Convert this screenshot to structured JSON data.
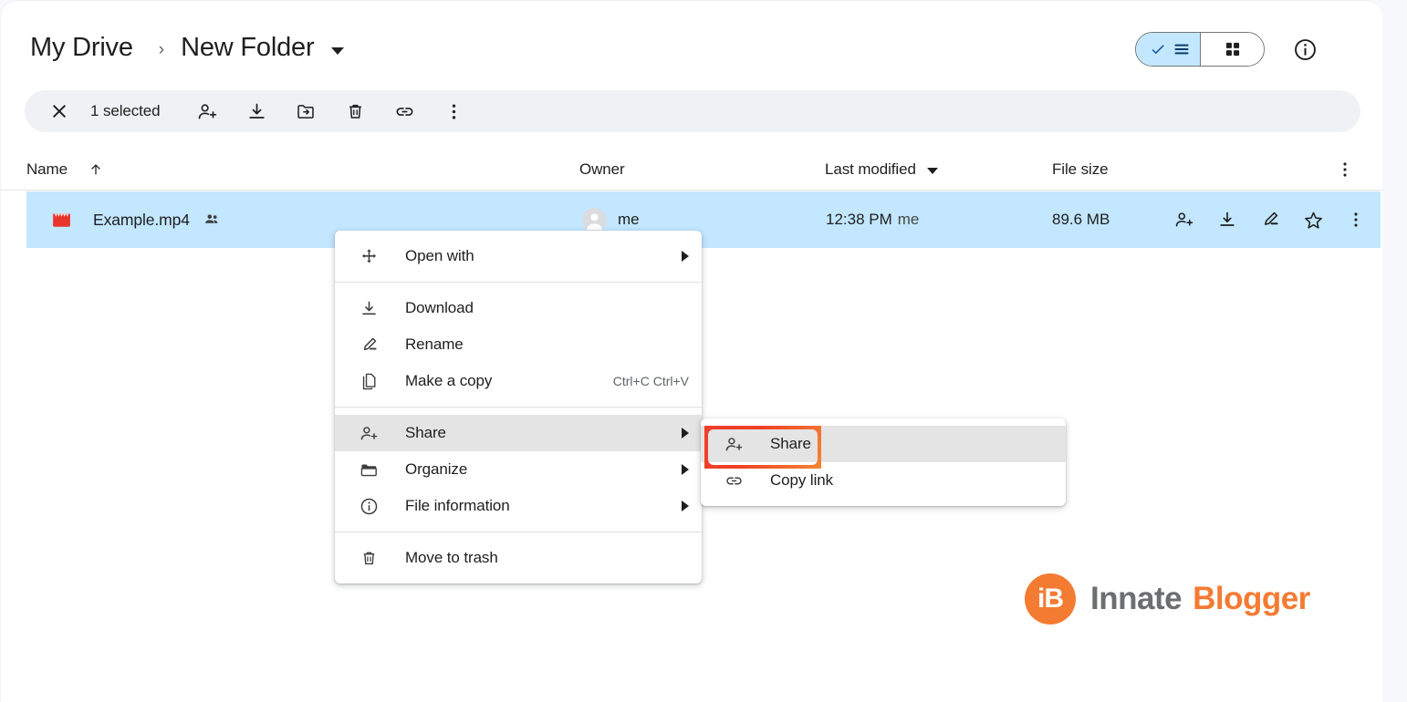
{
  "breadcrumb": {
    "root": "My Drive",
    "separator": "›",
    "current": "New Folder",
    "caret_icon": "chevron-down-icon"
  },
  "header": {
    "view_toggle": {
      "list_label": "list-view",
      "grid_label": "grid-view",
      "active": "list"
    },
    "info_icon": "info-icon"
  },
  "selection_bar": {
    "close_icon": "close-icon",
    "count_label": "1 selected",
    "actions": [
      {
        "name": "share-icon",
        "title": "Share"
      },
      {
        "name": "download-icon",
        "title": "Download"
      },
      {
        "name": "move-to-folder-icon",
        "title": "Move"
      },
      {
        "name": "trash-icon",
        "title": "Move to trash"
      },
      {
        "name": "link-icon",
        "title": "Copy link"
      },
      {
        "name": "more-vertical-icon",
        "title": "More actions"
      }
    ]
  },
  "table": {
    "columns": {
      "name": "Name",
      "owner": "Owner",
      "last_modified": "Last modified",
      "file_size": "File size"
    },
    "sort": {
      "column": "Name",
      "direction": "ascending",
      "icon": "arrow-up-icon"
    },
    "modified_caret_icon": "chevron-down-icon",
    "header_menu_icon": "more-vertical-icon",
    "rows": [
      {
        "file_icon": "video-file-icon",
        "name": "Example.mp4",
        "shared_icon": "people-shared-icon",
        "owner": "me",
        "last_modified_time": "12:38 PM",
        "last_modified_by": "me",
        "file_size": "89.6 MB",
        "selected": true,
        "actions": [
          {
            "name": "share-icon"
          },
          {
            "name": "download-icon"
          },
          {
            "name": "rename-icon"
          },
          {
            "name": "star-icon"
          },
          {
            "name": "more-vertical-icon"
          }
        ]
      }
    ]
  },
  "context_menu": {
    "items": [
      {
        "icon": "open-with-icon",
        "label": "Open with",
        "submenu": true,
        "shortcut": "",
        "hover": false,
        "separator_after": true
      },
      {
        "icon": "download-icon",
        "label": "Download",
        "submenu": false,
        "shortcut": "",
        "hover": false,
        "separator_after": false
      },
      {
        "icon": "rename-icon",
        "label": "Rename",
        "submenu": false,
        "shortcut": "",
        "hover": false,
        "separator_after": false
      },
      {
        "icon": "copy-icon",
        "label": "Make a copy",
        "submenu": false,
        "shortcut": "Ctrl+C Ctrl+V",
        "hover": false,
        "separator_after": true
      },
      {
        "icon": "share-icon",
        "label": "Share",
        "submenu": true,
        "shortcut": "",
        "hover": true,
        "separator_after": false
      },
      {
        "icon": "folder-icon",
        "label": "Organize",
        "submenu": true,
        "shortcut": "",
        "hover": false,
        "separator_after": false
      },
      {
        "icon": "info-icon",
        "label": "File information",
        "submenu": true,
        "shortcut": "",
        "hover": false,
        "separator_after": true
      },
      {
        "icon": "trash-icon",
        "label": "Move to trash",
        "submenu": false,
        "shortcut": "",
        "hover": false,
        "separator_after": false
      }
    ]
  },
  "share_submenu": {
    "items": [
      {
        "icon": "share-icon",
        "label": "Share",
        "hover": true,
        "highlighted": true
      },
      {
        "icon": "link-icon",
        "label": "Copy link",
        "hover": false,
        "highlighted": false
      }
    ],
    "highlight_color": "#ef4026"
  },
  "watermark": {
    "mark": "iB",
    "word_one": "Innate",
    "word_two": "Blogger",
    "color_primary": "#f47b32",
    "color_secondary": "#6d6e71"
  }
}
